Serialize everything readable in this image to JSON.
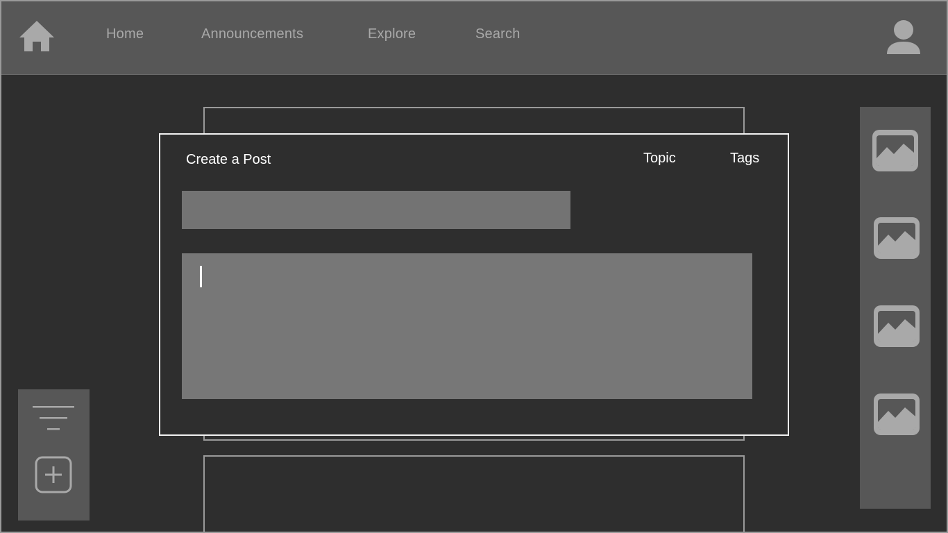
{
  "nav": {
    "home_icon": "home-icon",
    "links": [
      {
        "label": "Home"
      },
      {
        "label": "Announcements"
      },
      {
        "label": "Explore"
      },
      {
        "label": "Search"
      }
    ],
    "user_icon": "user-icon"
  },
  "modal": {
    "title": "Create a Post",
    "topic_label": "Topic",
    "tags_label": "Tags",
    "title_field_value": "",
    "body_field_value": ""
  },
  "left_panel": {
    "filter_icon": "filter-icon",
    "add_icon": "plus-square-icon"
  },
  "right_panel": {
    "images": [
      {
        "icon": "image-icon"
      },
      {
        "icon": "image-icon"
      },
      {
        "icon": "image-icon"
      },
      {
        "icon": "image-icon"
      }
    ]
  },
  "colors": {
    "background": "#2e2e2e",
    "bar": "#575757",
    "field": "#737373",
    "nav_text": "#a9a9a9",
    "modal_border": "#f2f2f2"
  }
}
